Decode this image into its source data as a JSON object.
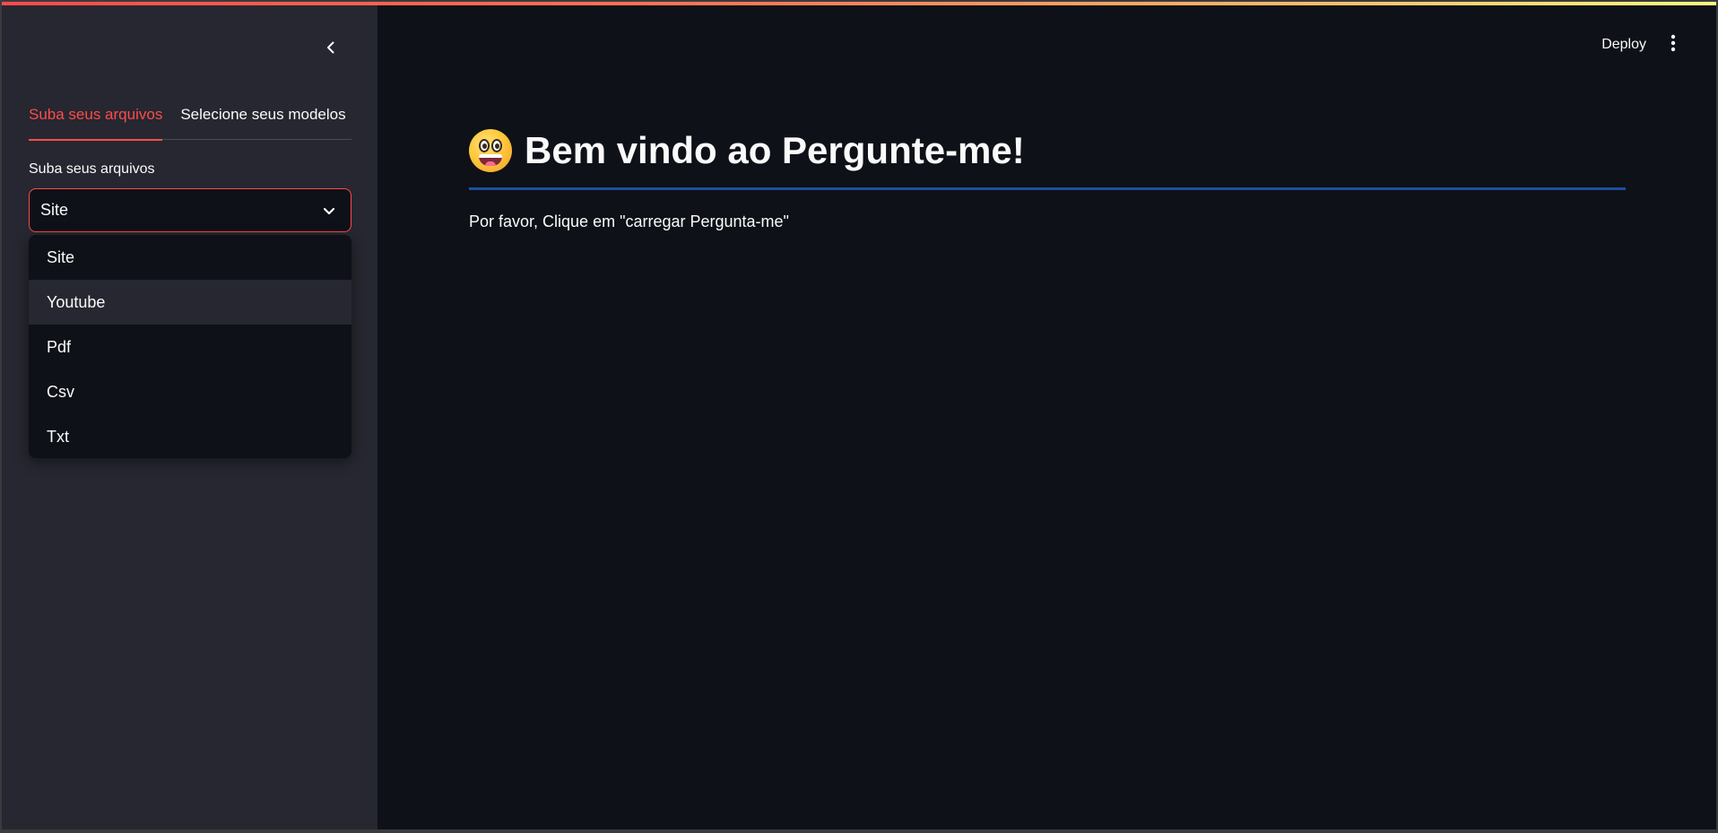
{
  "sidebar": {
    "tabs": [
      {
        "label": "Suba seus arquivos",
        "active": true
      },
      {
        "label": "Selecione seus modelos",
        "active": false
      }
    ],
    "field_label": "Suba seus arquivos",
    "select": {
      "value": "Site",
      "options": [
        "Site",
        "Youtube",
        "Pdf",
        "Csv",
        "Txt"
      ],
      "hovered_option": "Youtube"
    }
  },
  "toolbar": {
    "deploy_label": "Deploy"
  },
  "main": {
    "title": "Bem vindo ao Pergunte-me!",
    "title_emoji": "grinning-face-icon",
    "instruction": "Por favor, Clique em \"carregar Pergunta-me\""
  },
  "colors": {
    "accent": "#ff4b4b",
    "sidebar_bg": "#262730",
    "main_bg": "#0e1117",
    "divider": "#1c4f9e"
  }
}
